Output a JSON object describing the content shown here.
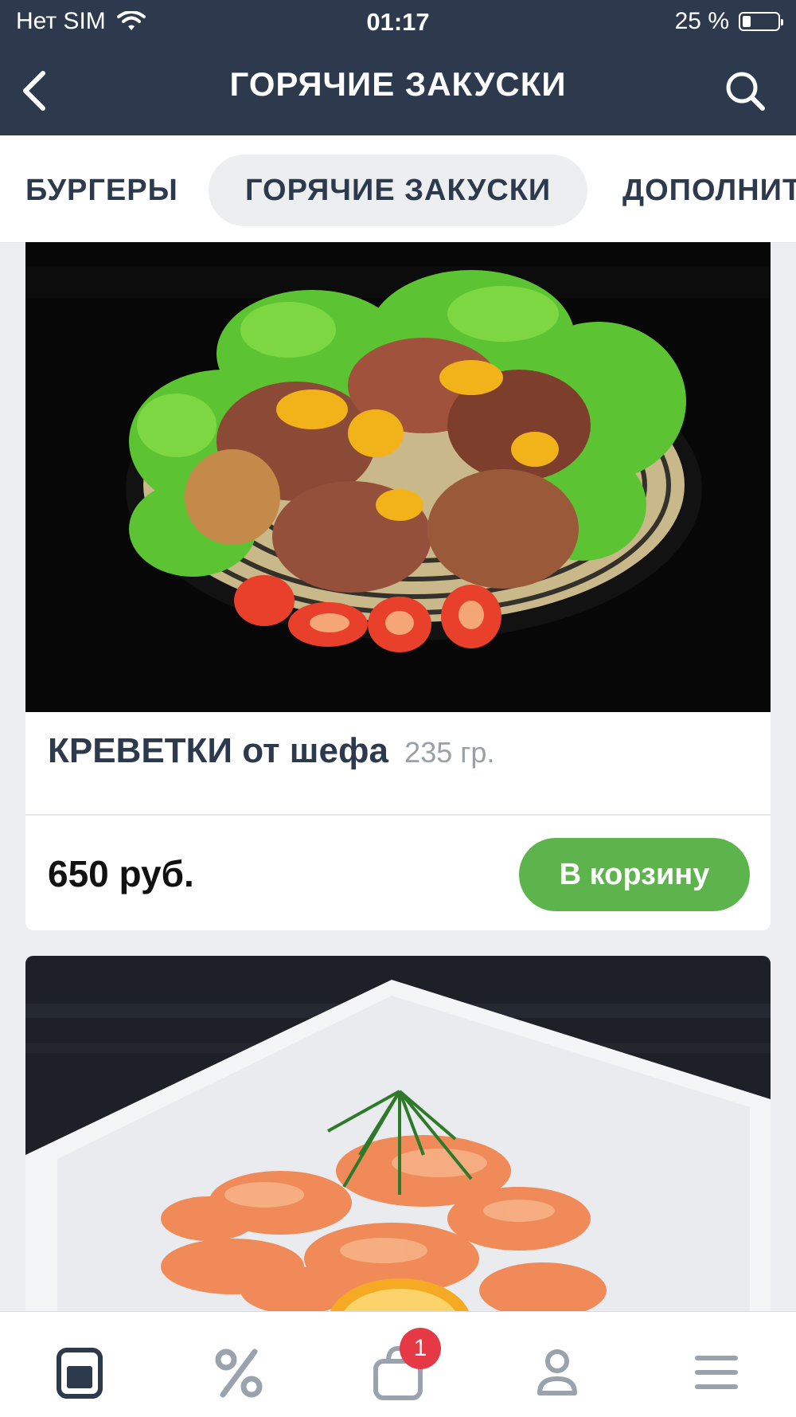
{
  "status": {
    "carrier": "Нет SIM",
    "time": "01:17",
    "battery": "25 %",
    "battery_level": 0.25
  },
  "header": {
    "title": "ГОРЯЧИЕ ЗАКУСКИ"
  },
  "tabs": [
    {
      "label": "БУРГЕРЫ"
    },
    {
      "label": "ГОРЯЧИЕ ЗАКУСКИ",
      "active": true
    },
    {
      "label": "ДОПОЛНИТ"
    }
  ],
  "products": [
    {
      "name": "КРЕВЕТКИ от шефа",
      "weight": "235 гр.",
      "price": "650 руб.",
      "button": "В корзину"
    }
  ],
  "bottom_nav": {
    "items": [
      "menu-icon",
      "discount-icon",
      "cart-icon",
      "profile-icon",
      "hamburger-icon"
    ],
    "cart_badge": "1"
  },
  "colors": {
    "header_bg": "#2d3a4e",
    "accent_green": "#5db34c",
    "badge_red": "#e53945"
  }
}
